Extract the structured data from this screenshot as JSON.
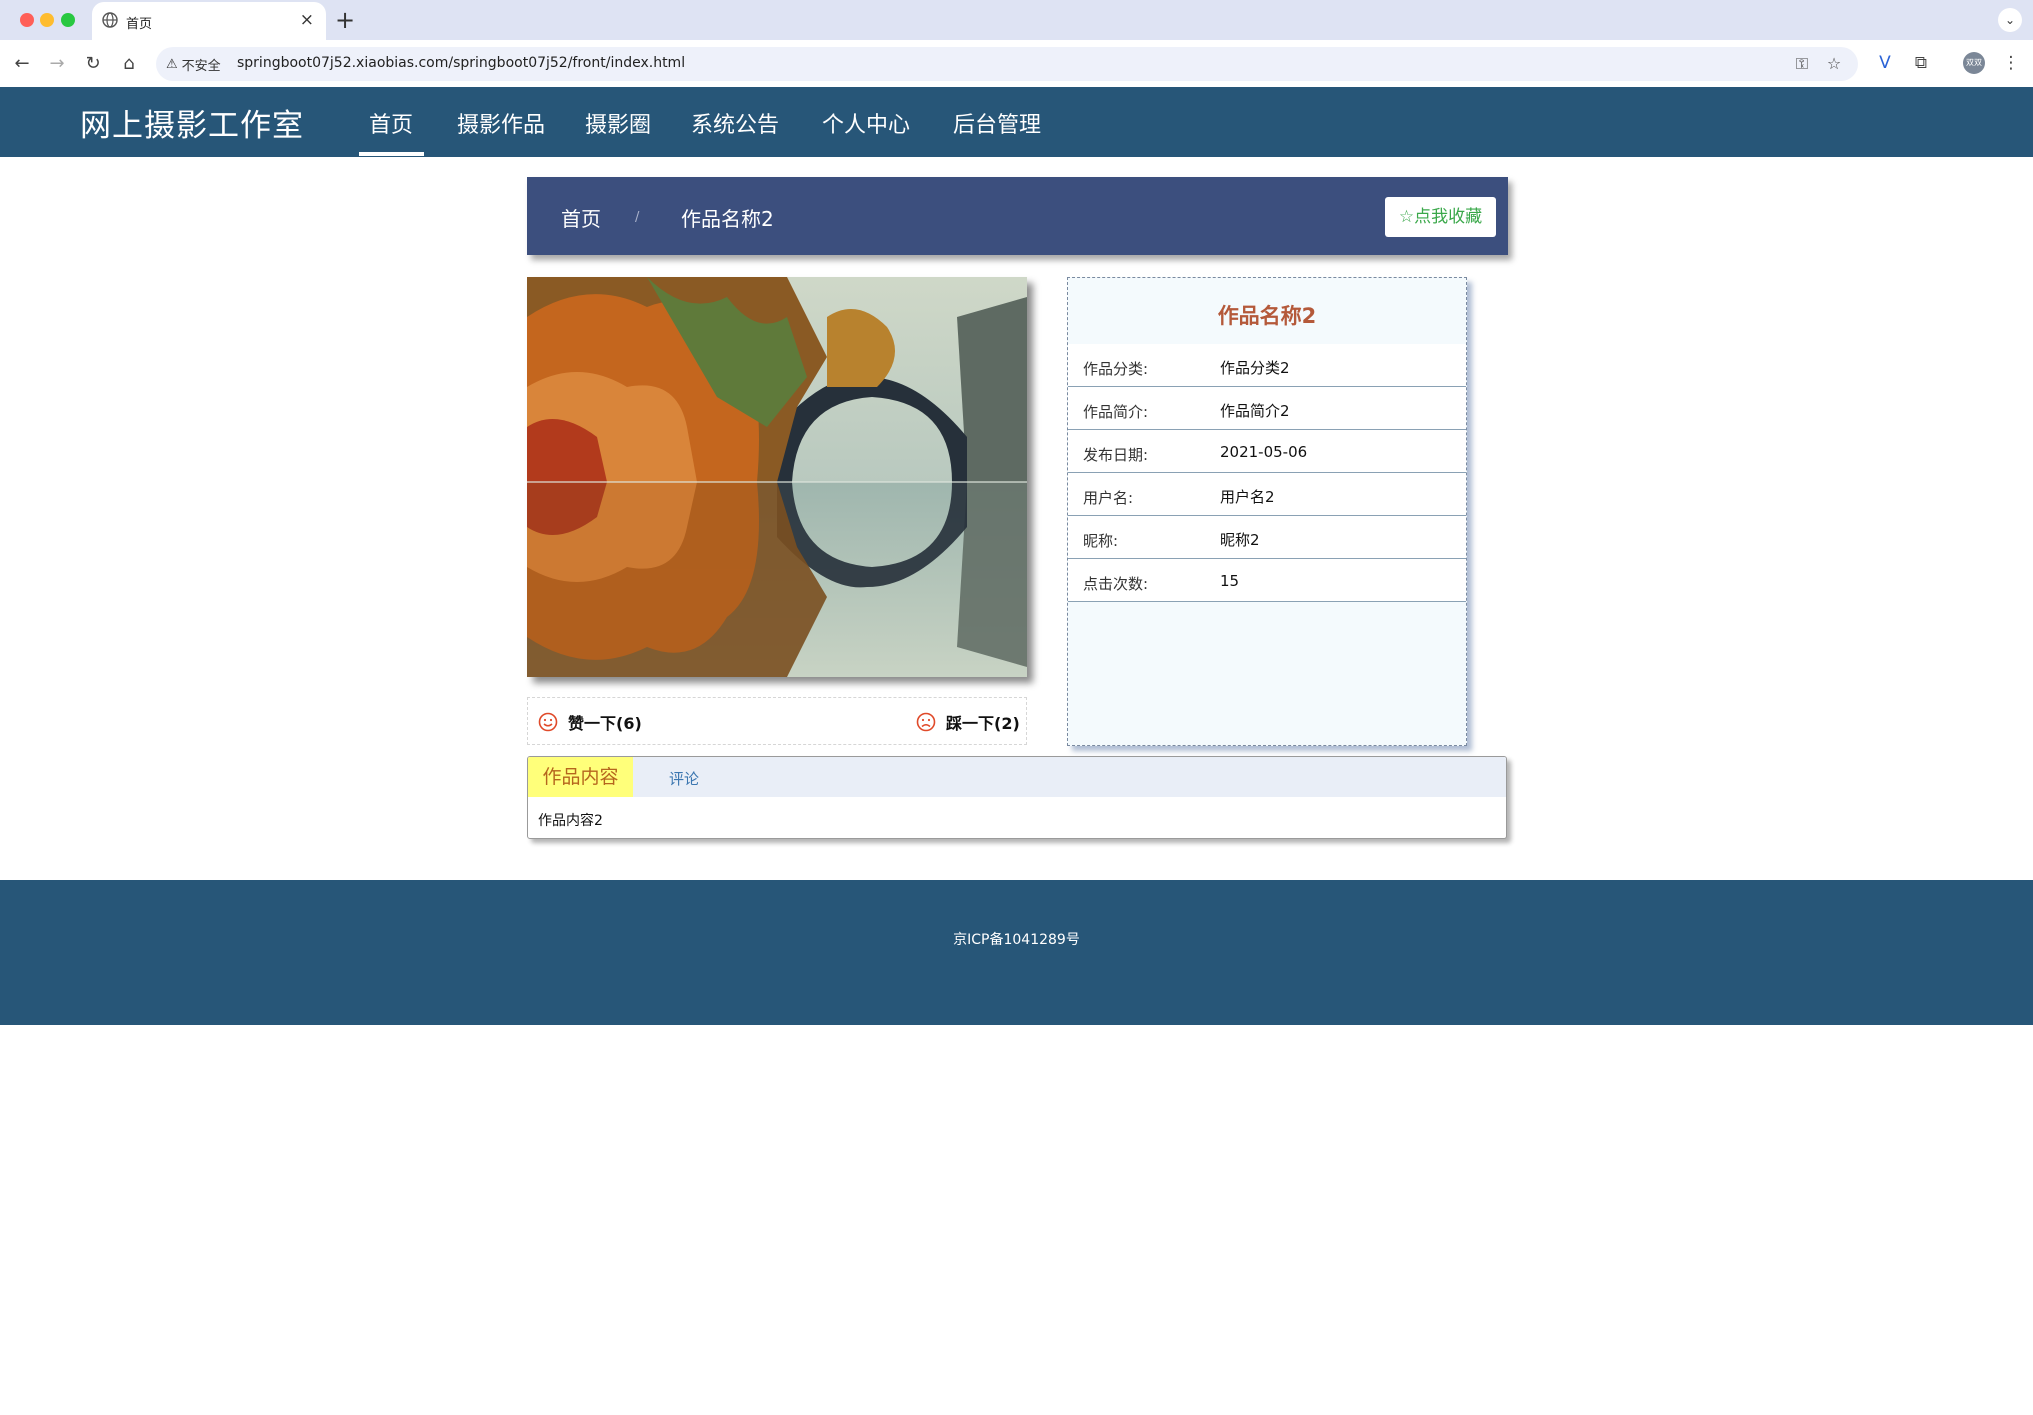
{
  "browser": {
    "tab_title": "首页",
    "insecure_label": "不安全",
    "url": "springboot07j52.xiaobias.com/springboot07j52/front/index.html",
    "avatar_text": "双双"
  },
  "site": {
    "brand": "网上摄影工作室",
    "nav": [
      "首页",
      "摄影作品",
      "摄影圈",
      "系统公告",
      "个人中心",
      "后台管理"
    ],
    "active_nav": "首页"
  },
  "breadcrumb": {
    "home": "首页",
    "separator": "/",
    "current": "作品名称2"
  },
  "favorite_button": "☆点我收藏",
  "votes": {
    "like_label": "赞一下(6)",
    "dislike_label": "踩一下(2)"
  },
  "detail": {
    "title": "作品名称2",
    "rows": [
      {
        "label": "作品分类:",
        "value": "作品分类2"
      },
      {
        "label": "作品简介:",
        "value": "作品简介2"
      },
      {
        "label": "发布日期:",
        "value": "2021-05-06"
      },
      {
        "label": "用户名:",
        "value": "用户名2"
      },
      {
        "label": "昵称:",
        "value": "昵称2"
      },
      {
        "label": "点击次数:",
        "value": "15"
      }
    ]
  },
  "tabs": {
    "content_tab": "作品内容",
    "comment_tab": "评论",
    "content_text": "作品内容2"
  },
  "footer": {
    "icp": "京ICP备1041289号"
  },
  "colors": {
    "header_bg": "#275678",
    "breadcrumb_bg": "#3c4f7e",
    "detail_title": "#b4593a",
    "favorite_text": "#3aa84a",
    "active_tab_bg": "#ffff7a"
  }
}
